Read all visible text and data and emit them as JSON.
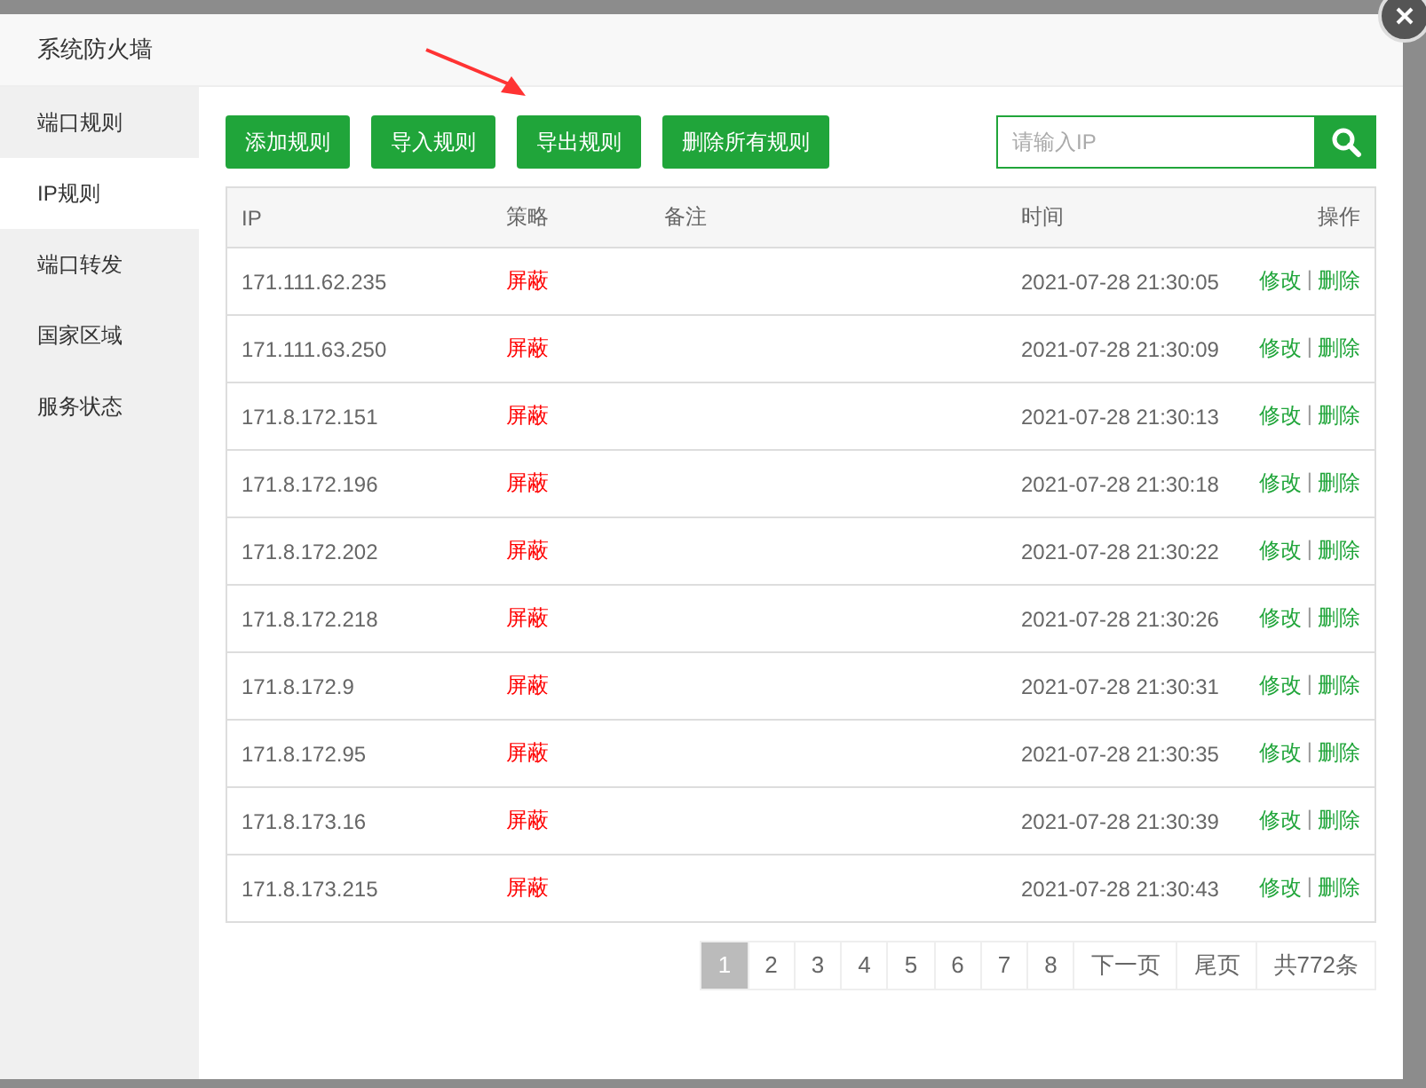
{
  "dialog": {
    "title": "系统防火墙"
  },
  "sidebar": {
    "items": [
      {
        "label": "端口规则",
        "selected": false
      },
      {
        "label": "IP规则",
        "selected": true
      },
      {
        "label": "端口转发",
        "selected": false
      },
      {
        "label": "国家区域",
        "selected": false
      },
      {
        "label": "服务状态",
        "selected": false
      }
    ]
  },
  "toolbar": {
    "buttons": [
      "添加规则",
      "导入规则",
      "导出规则",
      "删除所有规则"
    ],
    "search": {
      "placeholder": "请输入IP"
    }
  },
  "table": {
    "columns": [
      "IP",
      "策略",
      "备注",
      "时间",
      "操作"
    ],
    "rows": [
      {
        "ip": "171.111.62.235",
        "policy": "屏蔽",
        "note": "",
        "time": "2021-07-28 21:30:05",
        "actions": [
          "修改",
          "|",
          "删除"
        ]
      },
      {
        "ip": "171.111.63.250",
        "policy": "屏蔽",
        "note": "",
        "time": "2021-07-28 21:30:09",
        "actions": [
          "修改",
          "|",
          "删除"
        ]
      },
      {
        "ip": "171.8.172.151",
        "policy": "屏蔽",
        "note": "",
        "time": "2021-07-28 21:30:13",
        "actions": [
          "修改",
          "|",
          "删除"
        ]
      },
      {
        "ip": "171.8.172.196",
        "policy": "屏蔽",
        "note": "",
        "time": "2021-07-28 21:30:18",
        "actions": [
          "修改",
          "|",
          "删除"
        ]
      },
      {
        "ip": "171.8.172.202",
        "policy": "屏蔽",
        "note": "",
        "time": "2021-07-28 21:30:22",
        "actions": [
          "修改",
          "|",
          "删除"
        ]
      },
      {
        "ip": "171.8.172.218",
        "policy": "屏蔽",
        "note": "",
        "time": "2021-07-28 21:30:26",
        "actions": [
          "修改",
          "|",
          "删除"
        ]
      },
      {
        "ip": "171.8.172.9",
        "policy": "屏蔽",
        "note": "",
        "time": "2021-07-28 21:30:31",
        "actions": [
          "修改",
          "|",
          "删除"
        ]
      },
      {
        "ip": "171.8.172.95",
        "policy": "屏蔽",
        "note": "",
        "time": "2021-07-28 21:30:35",
        "actions": [
          "修改",
          "|",
          "删除"
        ]
      },
      {
        "ip": "171.8.173.16",
        "policy": "屏蔽",
        "note": "",
        "time": "2021-07-28 21:30:39",
        "actions": [
          "修改",
          "|",
          "删除"
        ]
      },
      {
        "ip": "171.8.173.215",
        "policy": "屏蔽",
        "note": "",
        "time": "2021-07-28 21:30:43",
        "actions": [
          "修改",
          "|",
          "删除"
        ]
      }
    ]
  },
  "pagination": {
    "pages": [
      {
        "label": "1",
        "selected": true
      },
      {
        "label": "2",
        "selected": false
      },
      {
        "label": "3",
        "selected": false
      },
      {
        "label": "4",
        "selected": false
      },
      {
        "label": "5",
        "selected": false
      },
      {
        "label": "6",
        "selected": false
      },
      {
        "label": "7",
        "selected": false
      },
      {
        "label": "8",
        "selected": false
      }
    ],
    "next": "下一页",
    "last": "尾页",
    "total": "共772条"
  }
}
